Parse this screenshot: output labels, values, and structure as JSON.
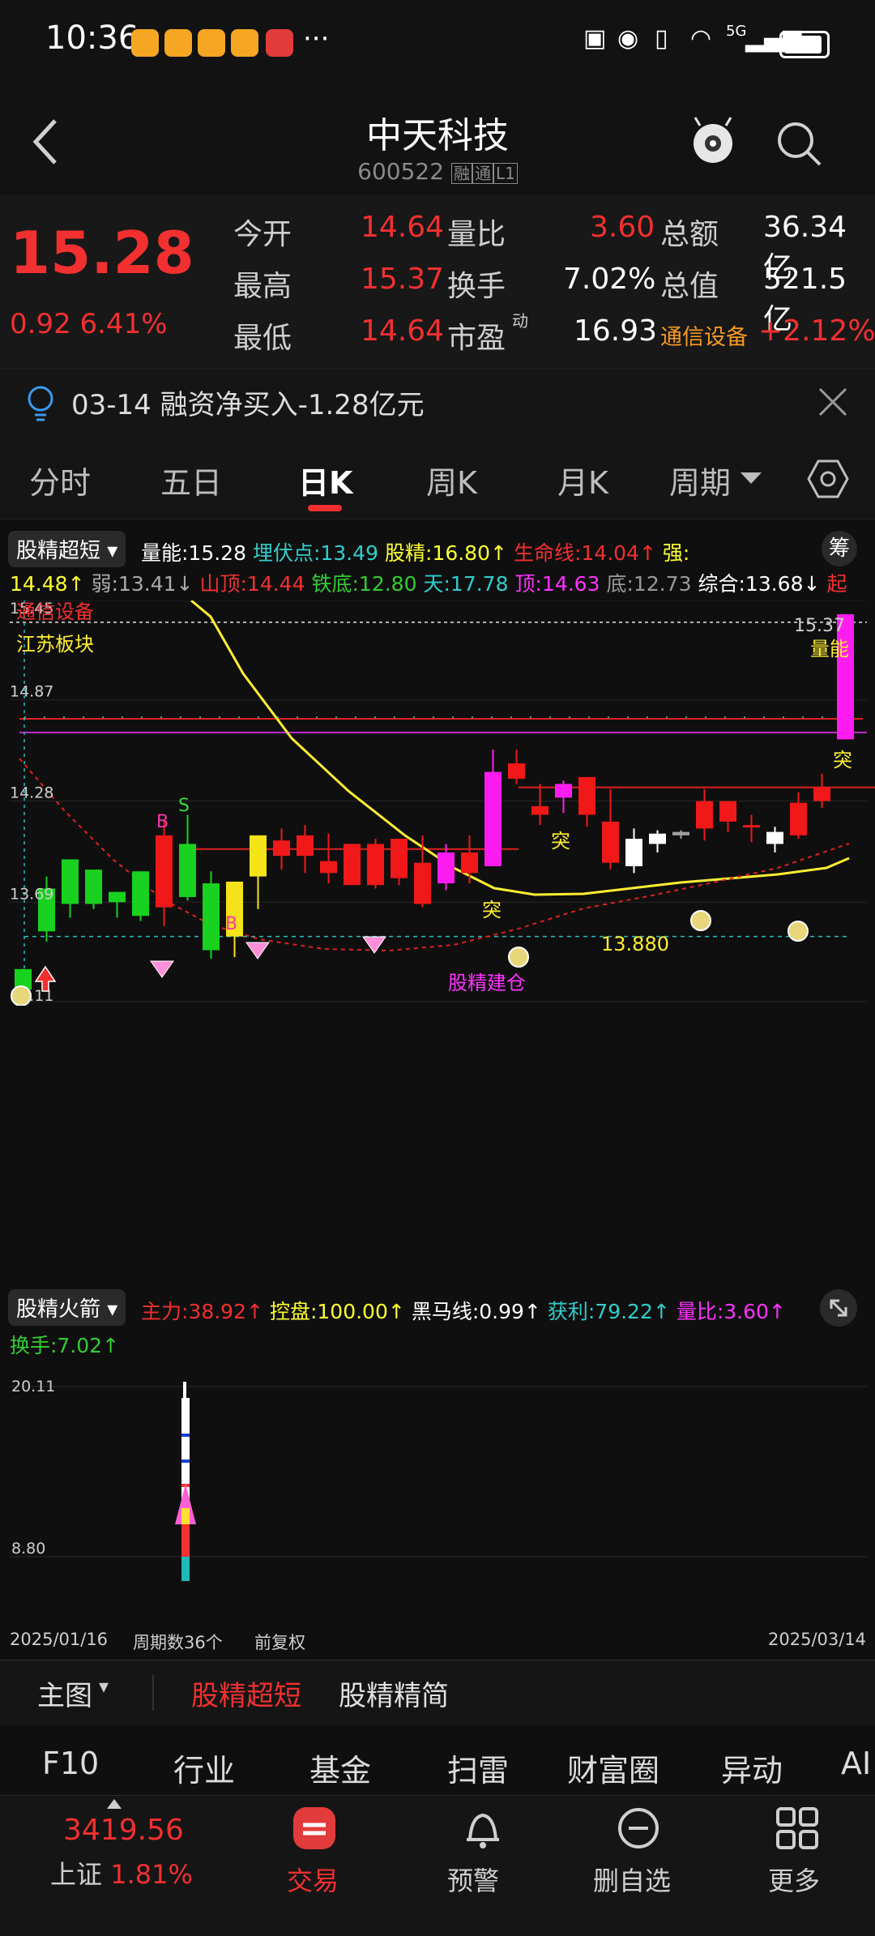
{
  "status": {
    "time": "10:36",
    "right": "5G"
  },
  "header": {
    "title": "中天科技",
    "code": "600522",
    "badges": [
      "融",
      "通",
      "L1"
    ]
  },
  "quote": {
    "price": "15.28",
    "change": "0.92",
    "change_pct": "6.41%",
    "rows": [
      {
        "l1": "今开",
        "v1": "14.64",
        "l2": "量比",
        "v2": "3.60",
        "l3": "总额",
        "v3": "36.34亿"
      },
      {
        "l1": "最高",
        "v1": "15.37",
        "l2": "换手",
        "v2": "7.02%",
        "l3": "总值",
        "v3": "521.5亿"
      },
      {
        "l1": "最低",
        "v1": "14.64",
        "l2": "市盈",
        "l2sup": "动",
        "v2": "16.93",
        "l3": "通信设备",
        "v3": "+2.12%"
      }
    ]
  },
  "banner": {
    "text": "03-14 融资净买入-1.28亿元"
  },
  "tabs": [
    "分时",
    "五日",
    "日K",
    "周K",
    "月K",
    "周期"
  ],
  "active_tab": "日K",
  "indicator1": {
    "selector": "股精超短",
    "chip_btn": "筹",
    "line1": [
      {
        "t": "量能:15.28",
        "c": "#ffffff"
      },
      {
        "t": "埋伏点:13.49",
        "c": "#33cccc"
      },
      {
        "t": "股精:16.80↑",
        "c": "#ffff33"
      },
      {
        "t": "生命线:14.04↑",
        "c": "#f23030"
      },
      {
        "t": "强:",
        "c": "#ffff33"
      }
    ],
    "line2": [
      {
        "t": "14.48↑",
        "c": "#ffff33"
      },
      {
        "t": "弱:13.41↓",
        "c": "#aaaaaa"
      },
      {
        "t": "山顶:14.44",
        "c": "#f23030"
      },
      {
        "t": "铁底:12.80",
        "c": "#33cc33"
      },
      {
        "t": "天:17.78",
        "c": "#33cccc"
      },
      {
        "t": "顶:14.63",
        "c": "#ff33ff"
      },
      {
        "t": "底:12.73",
        "c": "#999999"
      },
      {
        "t": "综合:13.68↓",
        "c": "#ffffff"
      },
      {
        "t": "起",
        "c": "#f23030"
      }
    ]
  },
  "chart_labels": {
    "y_top": "15.45",
    "y_2": "14.87",
    "y_3": "14.28",
    "y_4": "13.69",
    "y_bottom": "13.11",
    "sector": "通信设备",
    "region": "江苏板块",
    "max_label": "15.37",
    "volume_label": "量能",
    "min_label": "13.880",
    "build_label": "股精建仓",
    "tu": "突"
  },
  "chart_data": {
    "type": "candlestick",
    "y_range": [
      13.11,
      15.45
    ],
    "candles": [
      {
        "o": 13.3,
        "c": 13.18,
        "h": 13.3,
        "l": 13.15,
        "col": "g"
      },
      {
        "o": 13.52,
        "c": 13.77,
        "h": 13.84,
        "l": 13.46,
        "col": "g"
      },
      {
        "o": 13.68,
        "c": 13.94,
        "h": 13.94,
        "l": 13.6,
        "col": "g"
      },
      {
        "o": 13.68,
        "c": 13.88,
        "h": 13.88,
        "l": 13.65,
        "col": "g"
      },
      {
        "o": 13.69,
        "c": 13.75,
        "h": 13.75,
        "l": 13.6,
        "col": "g"
      },
      {
        "o": 13.61,
        "c": 13.87,
        "h": 13.87,
        "l": 13.58,
        "col": "g"
      },
      {
        "o": 14.08,
        "c": 13.66,
        "h": 14.17,
        "l": 13.55,
        "col": "r"
      },
      {
        "o": 13.72,
        "c": 14.03,
        "h": 14.2,
        "l": 13.7,
        "col": "g"
      },
      {
        "o": 13.8,
        "c": 13.41,
        "h": 13.87,
        "l": 13.36,
        "col": "g"
      },
      {
        "o": 13.49,
        "c": 13.81,
        "h": 13.81,
        "l": 13.37,
        "col": "y"
      },
      {
        "o": 13.84,
        "c": 14.08,
        "h": 14.08,
        "l": 13.65,
        "col": "y"
      },
      {
        "o": 14.05,
        "c": 13.96,
        "h": 14.12,
        "l": 13.88,
        "col": "r"
      },
      {
        "o": 14.08,
        "c": 13.96,
        "h": 14.14,
        "l": 13.86,
        "col": "r"
      },
      {
        "o": 13.93,
        "c": 13.86,
        "h": 14.09,
        "l": 13.8,
        "col": "r"
      },
      {
        "o": 14.03,
        "c": 13.79,
        "h": 14.03,
        "l": 13.79,
        "col": "r"
      },
      {
        "o": 14.03,
        "c": 13.79,
        "h": 14.06,
        "l": 13.77,
        "col": "r"
      },
      {
        "o": 14.06,
        "c": 13.83,
        "h": 14.06,
        "l": 13.79,
        "col": "r"
      },
      {
        "o": 13.92,
        "c": 13.68,
        "h": 14.08,
        "l": 13.66,
        "col": "r"
      },
      {
        "o": 13.98,
        "c": 13.8,
        "h": 14.03,
        "l": 13.76,
        "col": "m"
      },
      {
        "o": 13.98,
        "c": 13.86,
        "h": 14.08,
        "l": 13.8,
        "col": "r"
      },
      {
        "o": 14.45,
        "c": 13.9,
        "h": 14.58,
        "l": 13.9,
        "col": "m"
      },
      {
        "o": 14.5,
        "c": 14.41,
        "h": 14.58,
        "l": 14.38,
        "col": "r"
      },
      {
        "o": 14.25,
        "c": 14.2,
        "h": 14.38,
        "l": 14.14,
        "col": "r"
      },
      {
        "o": 14.38,
        "c": 14.3,
        "h": 14.4,
        "l": 14.21,
        "col": "m"
      },
      {
        "o": 14.42,
        "c": 14.2,
        "h": 14.42,
        "l": 14.13,
        "col": "r"
      },
      {
        "o": 14.16,
        "c": 13.92,
        "h": 14.35,
        "l": 13.88,
        "col": "r"
      },
      {
        "o": 13.9,
        "c": 14.06,
        "h": 14.12,
        "l": 13.86,
        "col": "w"
      },
      {
        "o": 14.03,
        "c": 14.09,
        "h": 14.11,
        "l": 13.98,
        "col": "w"
      },
      {
        "o": 14.08,
        "c": 14.1,
        "h": 14.11,
        "l": 14.06,
        "col": "s"
      },
      {
        "o": 14.28,
        "c": 14.12,
        "h": 14.35,
        "l": 14.05,
        "col": "r"
      },
      {
        "o": 14.28,
        "c": 14.16,
        "h": 14.28,
        "l": 14.1,
        "col": "r"
      },
      {
        "o": 14.14,
        "c": 14.13,
        "h": 14.2,
        "l": 14.04,
        "col": "r"
      },
      {
        "o": 14.1,
        "c": 14.03,
        "h": 14.13,
        "l": 13.98,
        "col": "w"
      },
      {
        "o": 14.27,
        "c": 14.08,
        "h": 14.33,
        "l": 14.06,
        "col": "r"
      },
      {
        "o": 14.36,
        "c": 14.28,
        "h": 14.44,
        "l": 14.24,
        "col": "r"
      },
      {
        "o": 15.37,
        "c": 14.64,
        "h": 15.37,
        "l": 14.64,
        "col": "m"
      }
    ]
  },
  "indicator2": {
    "selector": "股精火箭",
    "line1": [
      {
        "t": "主力:38.92↑",
        "c": "#f23030"
      },
      {
        "t": "控盘:100.00↑",
        "c": "#ffff33"
      },
      {
        "t": "黑马线:0.99↑",
        "c": "#ffffff"
      },
      {
        "t": "获利:79.22↑",
        "c": "#33cccc"
      },
      {
        "t": "量比:3.60↑",
        "c": "#ff33ff"
      }
    ],
    "line2": [
      {
        "t": "换手:7.02↑",
        "c": "#33cc33"
      }
    ],
    "y_top": "20.11",
    "y_bottom": "8.80"
  },
  "footer_axis": {
    "start": "2025/01/16",
    "count": "周期数36个",
    "adj": "前复权",
    "end": "2025/03/14"
  },
  "bottom_tabs": {
    "main": "主图",
    "items": [
      "股精超短",
      "股精精简"
    ]
  },
  "nav": [
    "F10",
    "行业",
    "基金",
    "扫雷",
    "财富圈",
    "异动",
    "AI"
  ],
  "dock": {
    "index_value": "3419.56",
    "index_name": "上证",
    "index_pct": "1.81%",
    "items": [
      "交易",
      "预警",
      "删自选",
      "更多"
    ]
  }
}
